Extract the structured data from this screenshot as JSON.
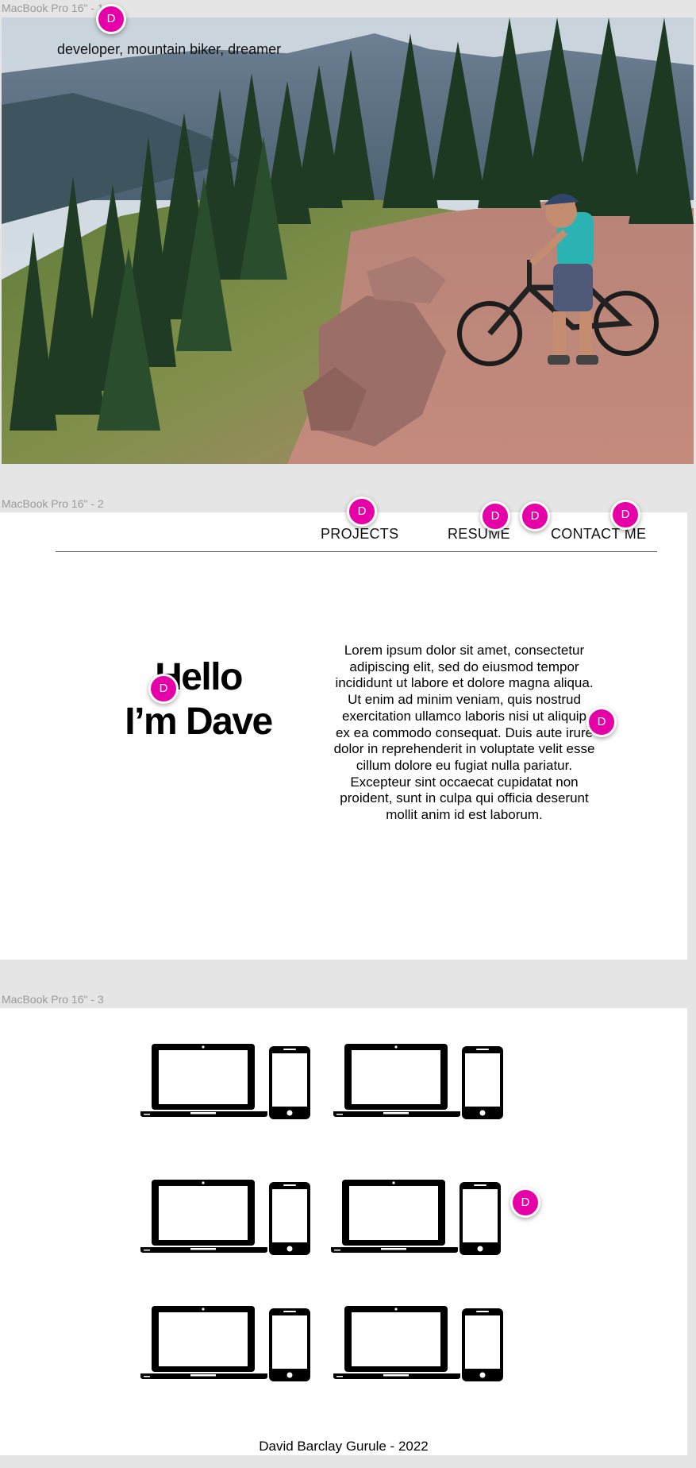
{
  "frames": [
    {
      "label": "MacBook Pro 16\" - 1"
    },
    {
      "label": "MacBook Pro 16\" - 2"
    },
    {
      "label": "MacBook Pro 16\" - 3"
    }
  ],
  "hero": {
    "tagline": "developer, mountain biker, dreamer",
    "photo_icon": "mountain-biker-photo"
  },
  "nav": {
    "projects": "PROJECTS",
    "resume": "RESUME",
    "contact": "CONTACT ME"
  },
  "intro": {
    "line1": "Hello",
    "line2": "I’m Dave",
    "body": "Lorem ipsum dolor sit amet, consectetur adipiscing elit, sed do eiusmod tempor incididunt ut labore et dolore magna aliqua. Ut enim ad minim veniam, quis nostrud exercitation ullamco laboris nisi ut aliquip ex ea commodo consequat. Duis aute irure dolor in reprehenderit in voluptate velit esse cillum dolore eu fugiat nulla pariatur. Excepteur sint occaecat cupidatat non proident, sunt in culpa qui officia deserunt mollit anim id est laborum."
  },
  "projects": {
    "device_icon": "laptop-phone-icon",
    "items": [
      {},
      {},
      {},
      {},
      {},
      {}
    ]
  },
  "footer": {
    "text": "David Barclay Gurule - 2022"
  },
  "collaborator": {
    "initial": "D",
    "color": "#e600a8"
  }
}
